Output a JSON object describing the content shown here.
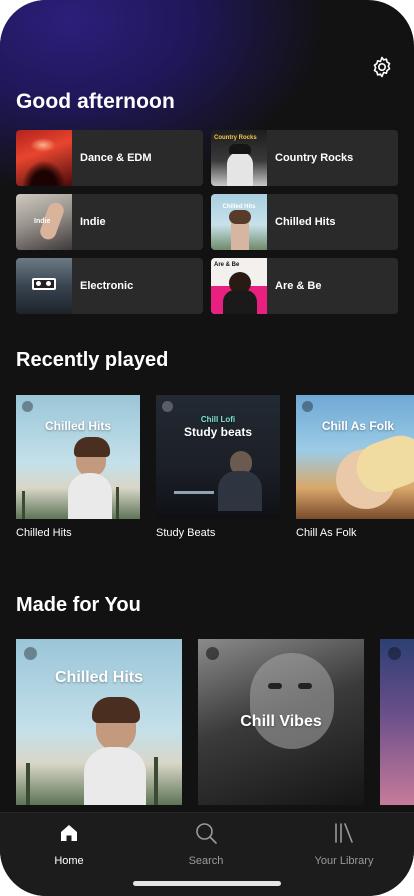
{
  "greeting": "Good afternoon",
  "quick_access": [
    {
      "label": "Dance & EDM",
      "cover_text": ""
    },
    {
      "label": "Country Rocks",
      "cover_text": "Country Rocks"
    },
    {
      "label": "Indie",
      "cover_text": "Indie"
    },
    {
      "label": "Chilled Hits",
      "cover_text": "Chilled Hits"
    },
    {
      "label": "Electronic",
      "cover_text": ""
    },
    {
      "label": "Are & Be",
      "cover_text": "Are & Be"
    }
  ],
  "recently_played": {
    "title": "Recently played",
    "items": [
      {
        "label": "Chilled Hits",
        "cover_title": "Chilled Hits"
      },
      {
        "label": "Study Beats",
        "cover_small": "Chill Lofi",
        "cover_title": "Study beats"
      },
      {
        "label": "Chill As Folk",
        "cover_title": "Chill As Folk"
      }
    ]
  },
  "made_for_you": {
    "title": "Made for You",
    "items": [
      {
        "cover_title": "Chilled Hits"
      },
      {
        "cover_title": "Chill Vibes"
      },
      {
        "cover_title": ""
      }
    ]
  },
  "nav": {
    "home": "Home",
    "search": "Search",
    "library": "Your Library"
  },
  "icons": {
    "settings": "gear-icon",
    "home": "home-icon",
    "search": "search-icon",
    "library": "library-icon"
  },
  "colors": {
    "background": "#121212",
    "card": "#2a2a2a",
    "header_glow": "#2b1f7a",
    "nav_bar": "#1c1c1c",
    "nav_inactive": "#9a9a9a"
  }
}
